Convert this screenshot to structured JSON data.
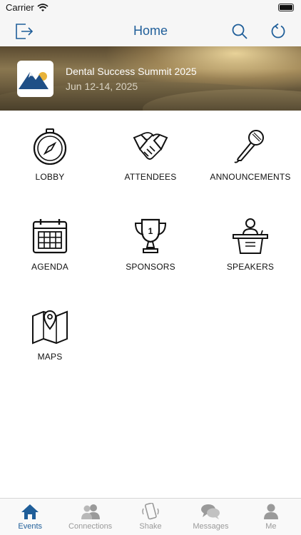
{
  "status_bar": {
    "carrier": "Carrier"
  },
  "nav": {
    "title": "Home"
  },
  "event": {
    "name": "Dental Success Summit 2025",
    "dates": "Jun 12-14, 2025"
  },
  "tiles": [
    {
      "label": "LOBBY",
      "icon": "compass-icon"
    },
    {
      "label": "ATTENDEES",
      "icon": "handshake-icon"
    },
    {
      "label": "ANNOUNCEMENTS",
      "icon": "microphone-icon"
    },
    {
      "label": "AGENDA",
      "icon": "calendar-icon"
    },
    {
      "label": "SPONSORS",
      "icon": "trophy-icon"
    },
    {
      "label": "SPEAKERS",
      "icon": "podium-icon"
    },
    {
      "label": "MAPS",
      "icon": "map-pin-icon"
    }
  ],
  "tabbar": {
    "items": [
      {
        "label": "Events",
        "icon": "house-icon",
        "active": true
      },
      {
        "label": "Connections",
        "icon": "people-icon",
        "active": false
      },
      {
        "label": "Shake",
        "icon": "shake-phone-icon",
        "active": false
      },
      {
        "label": "Messages",
        "icon": "chat-bubbles-icon",
        "active": false
      },
      {
        "label": "Me",
        "icon": "person-icon",
        "active": false
      }
    ]
  },
  "colors": {
    "accent": "#1f5e99",
    "inactive_tab": "#9a9a9a",
    "icon_stroke": "#111111"
  }
}
